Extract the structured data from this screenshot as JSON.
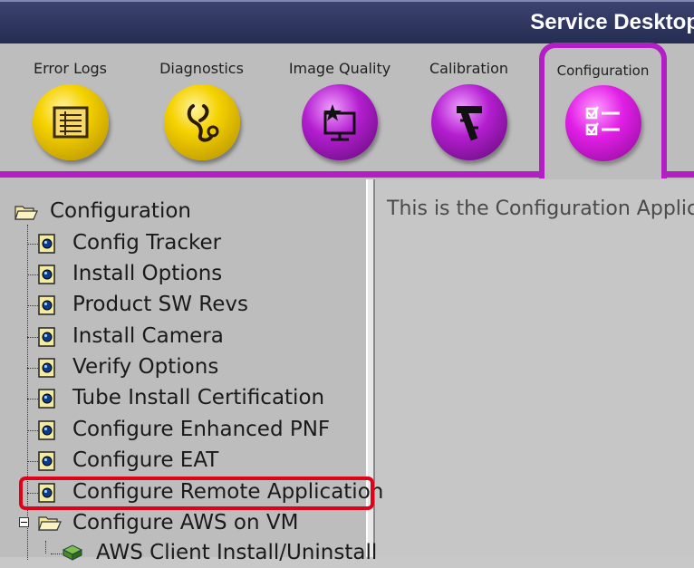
{
  "title": "Service Desktop",
  "tabs": [
    {
      "label": "Error Logs",
      "icon": "error-logs-icon",
      "color": "yellow"
    },
    {
      "label": "Diagnostics",
      "icon": "stethoscope-icon",
      "color": "yellow"
    },
    {
      "label": "Image Quality",
      "icon": "image-quality-monitor-icon",
      "color": "purple"
    },
    {
      "label": "Calibration",
      "icon": "caliper-icon",
      "color": "purple"
    },
    {
      "label": "Configuration",
      "icon": "checklist-icon",
      "color": "magenta",
      "active": true
    }
  ],
  "tree": {
    "root": "Configuration",
    "items": [
      "Config Tracker",
      "Install Options",
      "Product SW Revs",
      "Install Camera",
      "Verify Options",
      "Tube Install Certification",
      "Configure Enhanced PNF",
      "Configure EAT",
      "Configure Remote Application",
      "Configure AWS on VM",
      "AWS Client Install/Uninstall"
    ],
    "highlighted": "Configure Remote Application"
  },
  "content": {
    "message": "This is the Configuration Applica"
  },
  "colors": {
    "accent": "#b21fc2",
    "highlight": "#e0001a",
    "titlebar": "#2f3660"
  }
}
